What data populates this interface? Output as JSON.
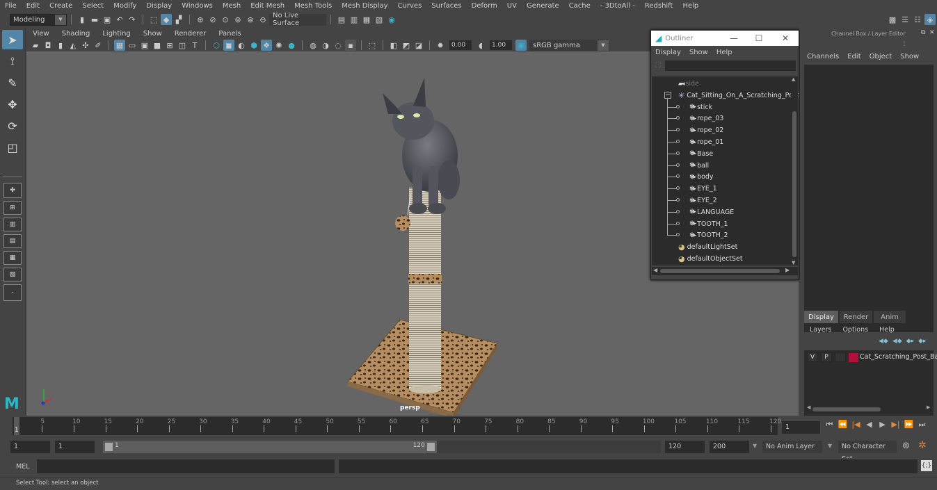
{
  "menubar": {
    "items": [
      "File",
      "Edit",
      "Create",
      "Select",
      "Modify",
      "Display",
      "Windows",
      "Mesh",
      "Edit Mesh",
      "Mesh Tools",
      "Mesh Display",
      "Curves",
      "Surfaces",
      "Deform",
      "UV",
      "Generate",
      "Cache",
      "- 3DtoAll -",
      "Redshift",
      "Help"
    ]
  },
  "shelf": {
    "workspace": "Modeling",
    "live_surface": "No Live Surface"
  },
  "viewport": {
    "menus": [
      "View",
      "Shading",
      "Lighting",
      "Show",
      "Renderer",
      "Panels"
    ],
    "exposure": "0.00",
    "gamma": "1.00",
    "color_space": "sRGB gamma",
    "camera_label": "persp"
  },
  "outliner": {
    "title": "Outliner",
    "menus": [
      "Display",
      "Show",
      "Help"
    ],
    "search_value": "",
    "items": [
      {
        "label": "side",
        "type": "camera",
        "depth": 0,
        "dim": true
      },
      {
        "label": "Cat_Sitting_On_A_Scratching_Post",
        "type": "group",
        "depth": 0,
        "expanded": true
      },
      {
        "label": "stick",
        "type": "mesh",
        "depth": 1
      },
      {
        "label": "rope_03",
        "type": "mesh",
        "depth": 1
      },
      {
        "label": "rope_02",
        "type": "mesh",
        "depth": 1
      },
      {
        "label": "rope_01",
        "type": "mesh",
        "depth": 1
      },
      {
        "label": "Base",
        "type": "mesh",
        "depth": 1
      },
      {
        "label": "ball",
        "type": "mesh",
        "depth": 1
      },
      {
        "label": "body",
        "type": "mesh",
        "depth": 1
      },
      {
        "label": "EYE_1",
        "type": "mesh",
        "depth": 1
      },
      {
        "label": "EYE_2",
        "type": "mesh",
        "depth": 1
      },
      {
        "label": "LANGUAGE",
        "type": "mesh",
        "depth": 1
      },
      {
        "label": "TOOTH_1",
        "type": "mesh",
        "depth": 1
      },
      {
        "label": "TOOTH_2",
        "type": "mesh",
        "depth": 1
      },
      {
        "label": "defaultLightSet",
        "type": "set",
        "depth": 0
      },
      {
        "label": "defaultObjectSet",
        "type": "set",
        "depth": 0
      }
    ]
  },
  "channelbox": {
    "title": "Channel Box / Layer Editor",
    "menus": [
      "Channels",
      "Edit",
      "Object",
      "Show"
    ],
    "tabs": [
      "Display",
      "Render",
      "Anim"
    ],
    "active_tab": "Display",
    "layer_menus": [
      "Layers",
      "Options",
      "Help"
    ],
    "layers": [
      {
        "v": "V",
        "p": "P",
        "color": "#b0103a",
        "name": "Cat_Scratching_Post_Ball"
      }
    ]
  },
  "timeline": {
    "ticks": [
      5,
      10,
      15,
      20,
      25,
      30,
      35,
      40,
      45,
      50,
      55,
      60,
      65,
      70,
      75,
      80,
      85,
      90,
      95,
      100,
      105,
      110,
      115,
      120
    ],
    "current_frame_marker": "1",
    "min": 1,
    "max": 120,
    "current_frame": "1"
  },
  "range": {
    "start": "1",
    "anim_start": "1",
    "slider_start": "1",
    "slider_end": "120",
    "end": "120",
    "anim_end": "200",
    "anim_layer": "No Anim Layer",
    "character_set": "No Character Set"
  },
  "command": {
    "label": "MEL",
    "value": ""
  },
  "status": {
    "help_text": "Select Tool: select an object"
  },
  "colors": {
    "accent": "#5285a6",
    "viewport_bg": "#656565",
    "panel_bg": "#444444",
    "field_bg": "#2b2b2b",
    "layer_color": "#b0103a"
  }
}
